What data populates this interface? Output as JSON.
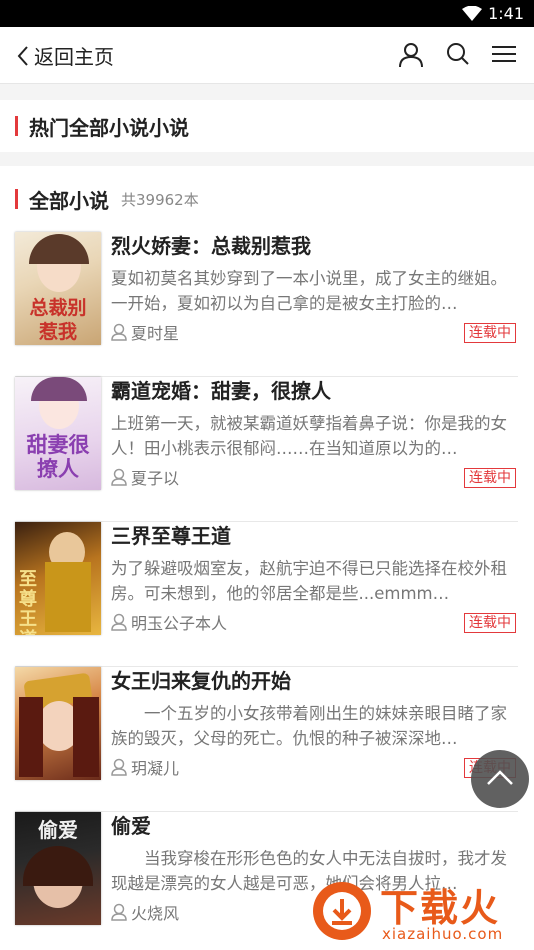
{
  "status": {
    "time": "1:41"
  },
  "header": {
    "back_label": "返回主页"
  },
  "hot_section": {
    "title": "热门全部小说小说"
  },
  "all_section": {
    "title": "全部小说",
    "count": "共39962本"
  },
  "books": [
    {
      "title": "烈火娇妻：总裁别惹我",
      "desc": "夏如初莫名其妙穿到了一本小说里，成了女主的继姐。一开始，夏如初以为自己拿的是被女主打脸的…",
      "author": "夏时星",
      "status": "连载中",
      "cover_text": "总裁别惹我"
    },
    {
      "title": "霸道宠婚：甜妻，很撩人",
      "desc": "上班第一天，就被某霸道妖孽指着鼻子说：你是我的女人！田小桃表示很郁闷……在当知道原以为的…",
      "author": "夏子以",
      "status": "连载中",
      "cover_text": "甜妻很撩人"
    },
    {
      "title": "三界至尊王道",
      "desc": "为了躲避吸烟室友，赵航宇迫不得已只能选择在校外租房。可未想到，他的邻居全都是些...emmm…",
      "author": "明玉公子本人",
      "status": "连载中",
      "cover_text": "至尊王道"
    },
    {
      "title": "女王归来复仇的开始",
      "desc": "　　一个五岁的小女孩带着刚出生的妹妹亲眼目睹了家族的毁灭，父母的死亡。仇恨的种子被深深地…",
      "author": "玥凝儿",
      "status": "连载中",
      "cover_text": ""
    },
    {
      "title": "偷爱",
      "desc": "　　当我穿梭在形形色色的女人中无法自拔时，我才发现越是漂亮的女人越是可恶，她们会将男人拉…",
      "author": "火烧风",
      "status": "",
      "cover_text": "偷爱"
    }
  ],
  "watermark": {
    "brand": "下载火",
    "url": "xiazaihuo.com"
  }
}
